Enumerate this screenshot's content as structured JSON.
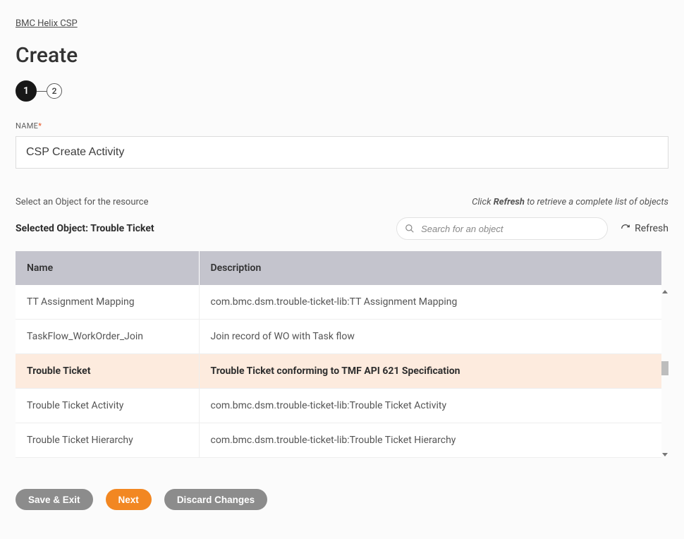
{
  "breadcrumb": "BMC Helix CSP",
  "page_title": "Create",
  "steps": {
    "active": "1",
    "inactive": "2"
  },
  "name_field": {
    "label": "NAME",
    "value": "CSP Create Activity"
  },
  "helper": {
    "select_object": "Select an Object for the resource",
    "hint_prefix": "Click ",
    "hint_bold": "Refresh",
    "hint_suffix": " to retrieve a complete list of objects"
  },
  "selected_object": {
    "label_prefix": "Selected Object: ",
    "value": "Trouble Ticket"
  },
  "search": {
    "placeholder": "Search for an object"
  },
  "refresh_label": "Refresh",
  "table": {
    "headers": {
      "name": "Name",
      "description": "Description"
    },
    "rows": [
      {
        "name": "TT Assignment Mapping",
        "description": "com.bmc.dsm.trouble-ticket-lib:TT Assignment Mapping",
        "selected": false
      },
      {
        "name": "TaskFlow_WorkOrder_Join",
        "description": "Join record of WO with Task flow",
        "selected": false
      },
      {
        "name": "Trouble Ticket",
        "description": "Trouble Ticket conforming to TMF API 621 Specification",
        "selected": true
      },
      {
        "name": "Trouble Ticket Activity",
        "description": "com.bmc.dsm.trouble-ticket-lib:Trouble Ticket Activity",
        "selected": false
      },
      {
        "name": "Trouble Ticket Hierarchy",
        "description": "com.bmc.dsm.trouble-ticket-lib:Trouble Ticket Hierarchy",
        "selected": false
      }
    ]
  },
  "footer": {
    "save_exit": "Save & Exit",
    "next": "Next",
    "discard": "Discard Changes"
  }
}
